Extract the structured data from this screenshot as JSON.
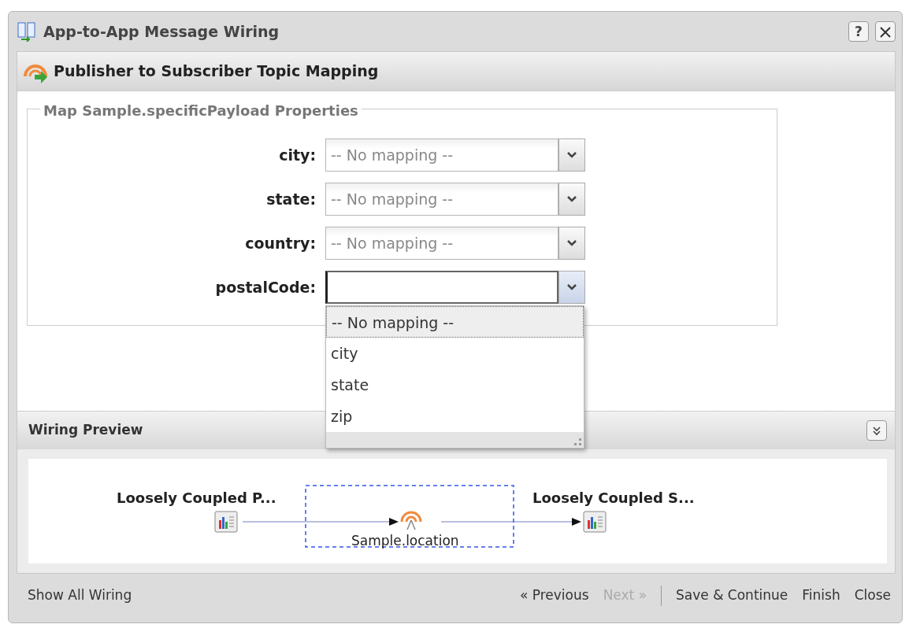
{
  "window": {
    "title": "App-to-App Message Wiring",
    "help": "?"
  },
  "panel": {
    "title": "Publisher to Subscriber Topic Mapping"
  },
  "fieldset": {
    "legend": "Map Sample.specificPayload Properties"
  },
  "fields": [
    {
      "label": "city:",
      "value": "-- No mapping --",
      "open": false
    },
    {
      "label": "state:",
      "value": "-- No mapping --",
      "open": false
    },
    {
      "label": "country:",
      "value": "-- No mapping --",
      "open": false
    },
    {
      "label": "postalCode:",
      "open": true
    }
  ],
  "dropdown": {
    "options": [
      {
        "label": "-- No mapping --",
        "selected": true
      },
      {
        "label": "city",
        "selected": false
      },
      {
        "label": "state",
        "selected": false
      },
      {
        "label": "zip",
        "selected": false
      }
    ]
  },
  "preview": {
    "title": "Wiring Preview",
    "publisher": "Loosely Coupled P...",
    "topic": "Sample.location",
    "topic_selected": true,
    "subscriber": "Loosely Coupled S..."
  },
  "footer": {
    "left": "Show All Wiring",
    "nav": [
      {
        "label": "« Previous",
        "disabled": false
      },
      {
        "label": "Next »",
        "disabled": true
      }
    ],
    "actions": [
      "Save & Continue",
      "Finish",
      "Close"
    ]
  }
}
